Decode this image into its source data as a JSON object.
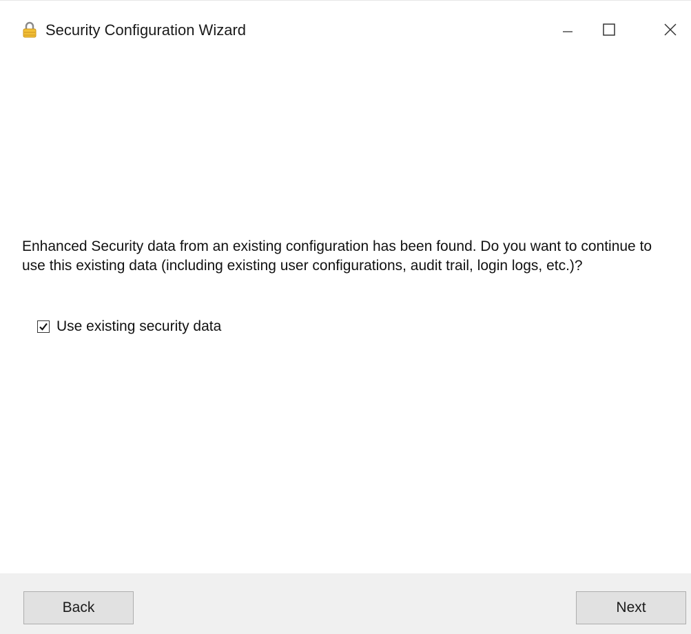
{
  "window": {
    "title": "Security Configuration Wizard",
    "icon": "lock-icon",
    "controls": {
      "minimize_icon": "minimize-icon",
      "maximize_icon": "maximize-icon",
      "close_icon": "close-icon"
    }
  },
  "main": {
    "message": "Enhanced Security data from an existing configuration has been found. Do you want to continue to use this existing data (including existing user configurations, audit trail, login logs, etc.)?",
    "checkbox": {
      "label": "Use existing security data",
      "checked": true
    }
  },
  "footer": {
    "back_label": "Back",
    "next_label": "Next"
  },
  "colors": {
    "footer_bg": "#f0f0f0",
    "button_bg": "#e1e1e1",
    "button_border": "#adadad",
    "lock_body": "#f2c037",
    "lock_shackle": "#8a8a8a"
  }
}
